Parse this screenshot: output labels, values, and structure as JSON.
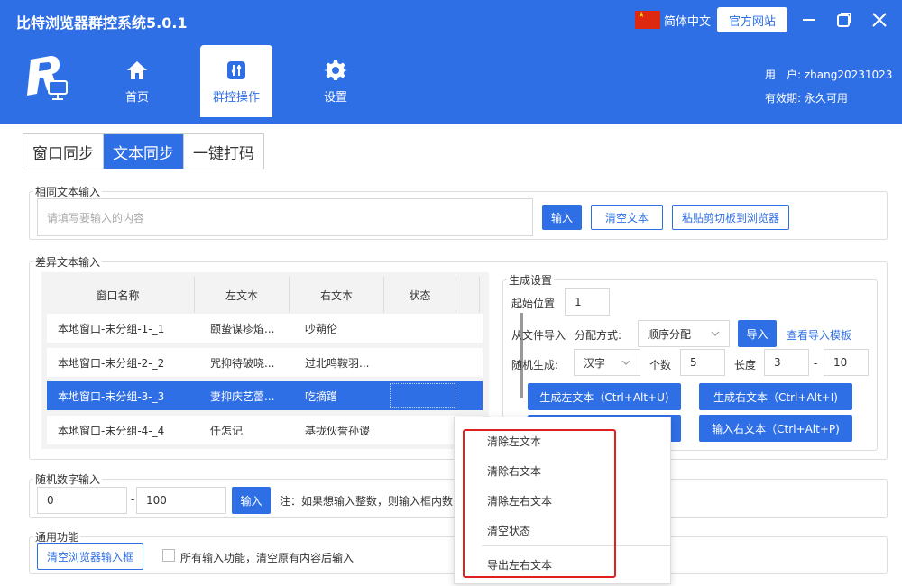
{
  "app": {
    "title": "比特浏览器群控系统5.0.1"
  },
  "header": {
    "language": "简体中文",
    "official_site": "官方网站",
    "nav": [
      {
        "label": "首页",
        "icon": "home-icon"
      },
      {
        "label": "群控操作",
        "icon": "sliders-icon",
        "active": true
      },
      {
        "label": "设置",
        "icon": "gear-icon"
      }
    ],
    "user_line": "用　户: zhang20231023",
    "expire_line": "有效期: 永久可用"
  },
  "tabs": [
    {
      "label": "窗口同步"
    },
    {
      "label": "文本同步",
      "active": true
    },
    {
      "label": "一键打码"
    }
  ],
  "same_text": {
    "legend": "相同文本输入",
    "placeholder": "请填写要输入的内容",
    "input_button": "输入",
    "clear_button": "清空文本",
    "paste_button": "粘贴剪切板到浏览器"
  },
  "diff_text": {
    "legend": "差异文本输入",
    "columns": [
      "窗口名称",
      "左文本",
      "右文本",
      "状态"
    ],
    "rows": [
      {
        "name": "本地窗口-未分组-1-_1",
        "left": "颐蛰谋疹焰...",
        "right": "吵蒴伦",
        "status": ""
      },
      {
        "name": "本地窗口-未分组-2-_2",
        "left": "咒抑待破晓...",
        "right": "过北鸣鞍羽...",
        "status": ""
      },
      {
        "name": "本地窗口-未分组-3-_3",
        "left": "妻抑庆艺蕾...",
        "right": "吃摘蹭",
        "status": "",
        "selected": true
      },
      {
        "name": "本地窗口-未分组-4-_4",
        "left": "仟怎记",
        "right": "基拢伙誉孙谡",
        "status": ""
      }
    ]
  },
  "gen_settings": {
    "legend": "生成设置",
    "start_label": "起始位置",
    "start_value": "1",
    "file_import_label": "从文件导入",
    "alloc_label": "分配方式:",
    "alloc_value": "顺序分配",
    "import_button": "导入",
    "template_link": "查看导入模板",
    "random_label": "随机生成:",
    "random_type": "汉字",
    "count_label": "个数",
    "count_value": "5",
    "length_label": "长度",
    "length_min": "3",
    "length_sep": "-",
    "length_max": "10",
    "gen_left_button": "生成左文本（Ctrl+Alt+U)",
    "gen_right_button": "生成右文本（Ctrl+Alt+I)",
    "input_right_button": "输入右文本（Ctrl+Alt+P)"
  },
  "random_number": {
    "legend": "随机数字输入",
    "min_value": "0",
    "sep": "-",
    "max_value": "100",
    "input_button": "输入",
    "note": "注：如果想输入整数，则输入框内数"
  },
  "common": {
    "legend": "通用功能",
    "clear_button": "清空浏览器输入框",
    "checkbox_label": "所有输入功能，清空原有内容后输入"
  },
  "context_menu": {
    "items": [
      "清除左文本",
      "清除右文本",
      "清除左右文本",
      "清空状态",
      "导出左右文本"
    ]
  },
  "colors": {
    "accent": "#2f6fe6",
    "highlight": "#e02020"
  }
}
